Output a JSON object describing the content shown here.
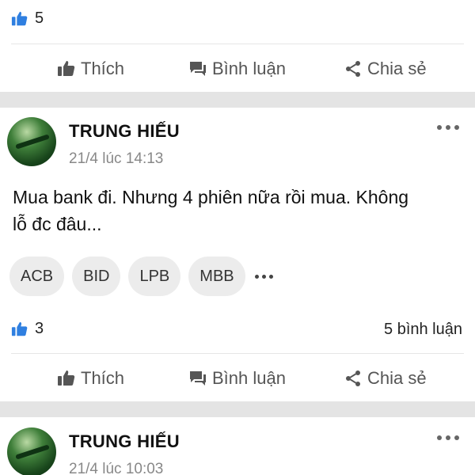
{
  "top_post": {
    "likes": "5",
    "actions": {
      "like": "Thích",
      "comment": "Bình luận",
      "share": "Chia sẻ"
    }
  },
  "post1": {
    "author": "TRUNG HIẾU",
    "time": "21/4 lúc 14:13",
    "text_line1": "Mua bank đi. Nhưng 4 phiên nữa rồi mua. Không",
    "text_line2": "lỗ đc đâu...",
    "tags": [
      "ACB",
      "BID",
      "LPB",
      "MBB"
    ],
    "likes": "3",
    "comments": "5 bình luận",
    "actions": {
      "like": "Thích",
      "comment": "Bình luận",
      "share": "Chia sẻ"
    }
  },
  "post2": {
    "author": "TRUNG HIẾU",
    "time": "21/4 lúc 10:03"
  },
  "colors": {
    "like_icon": "#2f7fe0",
    "separator": "#e4e4e4",
    "action_text": "#555555"
  },
  "icons": {
    "like_count": "thumbs-up-icon",
    "like_action": "thumbs-up-outline-icon",
    "comment_action": "chat-bubble-icon",
    "share_action": "share-icon",
    "more": "more-horizontal-icon"
  }
}
